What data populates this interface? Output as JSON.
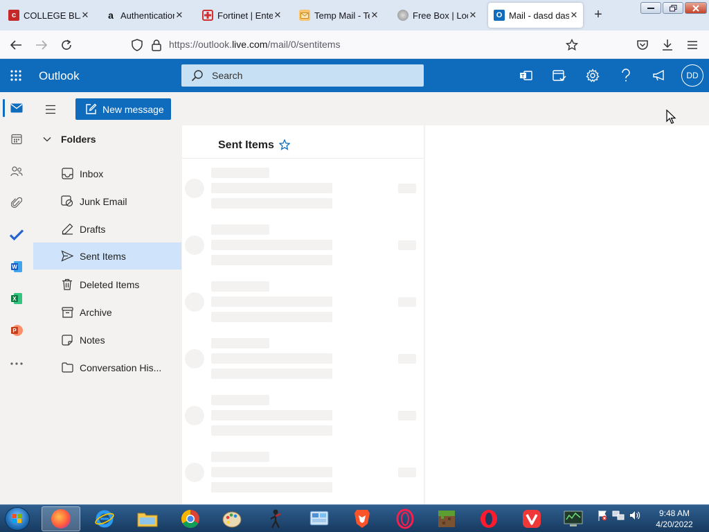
{
  "browser": {
    "tabs": [
      {
        "title": "COLLEGE BLAISE",
        "favicon": "college-favicon",
        "close": "✕"
      },
      {
        "title": "Authentication",
        "favicon": "amazon-favicon",
        "close": "✕"
      },
      {
        "title": "Fortinet | Enterp",
        "favicon": "fortinet-favicon",
        "close": "✕"
      },
      {
        "title": "Temp Mail - Ten",
        "favicon": "tempmail-favicon",
        "close": "✕"
      },
      {
        "title": "Free Box | Lootie",
        "favicon": "lootie-favicon",
        "close": "✕"
      },
      {
        "title": "Mail - dasd dasd",
        "favicon": "outlook-favicon",
        "close": "✕",
        "active": true
      }
    ],
    "new_tab": "+",
    "url": {
      "prefix": "https://outlook.",
      "domain": "live.com",
      "path": "/mail/0/sentitems"
    }
  },
  "outlook": {
    "brand": "Outlook",
    "search_placeholder": "Search",
    "avatar_initials": "DD",
    "new_message_label": "New message",
    "folders_heading": "Folders",
    "folders": [
      {
        "label": "Inbox",
        "icon": "inbox-icon"
      },
      {
        "label": "Junk Email",
        "icon": "junk-icon"
      },
      {
        "label": "Drafts",
        "icon": "drafts-icon"
      },
      {
        "label": "Sent Items",
        "icon": "sent-icon",
        "selected": true
      },
      {
        "label": "Deleted Items",
        "icon": "trash-icon"
      },
      {
        "label": "Archive",
        "icon": "archive-icon"
      },
      {
        "label": "Notes",
        "icon": "notes-icon"
      },
      {
        "label": "Conversation His...",
        "icon": "folder-icon"
      }
    ],
    "list_title": "Sent Items"
  },
  "taskbar": {
    "time": "9:48 AM",
    "date": "4/20/2022"
  },
  "colors": {
    "accent": "#0f6cbd",
    "selected": "#cfe4fa",
    "search_bg": "#c7e0f4",
    "skeleton": "#f3f2f1"
  }
}
